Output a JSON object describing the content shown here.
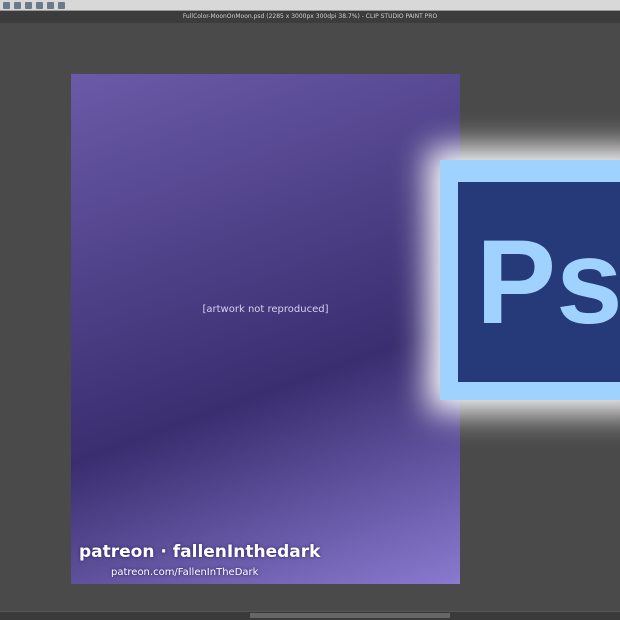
{
  "window": {
    "title": "FullColor-MoonOnMoon.psd (2285 x 3000px 300dpi 38.7%) - CLIP STUDIO PAINT PRO"
  },
  "canvas": {
    "note": "[artwork not reproduced]",
    "watermark": "patreon · fallenInthedark",
    "watermark_url": "patreon.com/FallenInTheDark"
  },
  "overlay": {
    "logo_text": "Ps",
    "logo_bg": "#263a7a",
    "logo_fg": "#9fd2ff"
  }
}
